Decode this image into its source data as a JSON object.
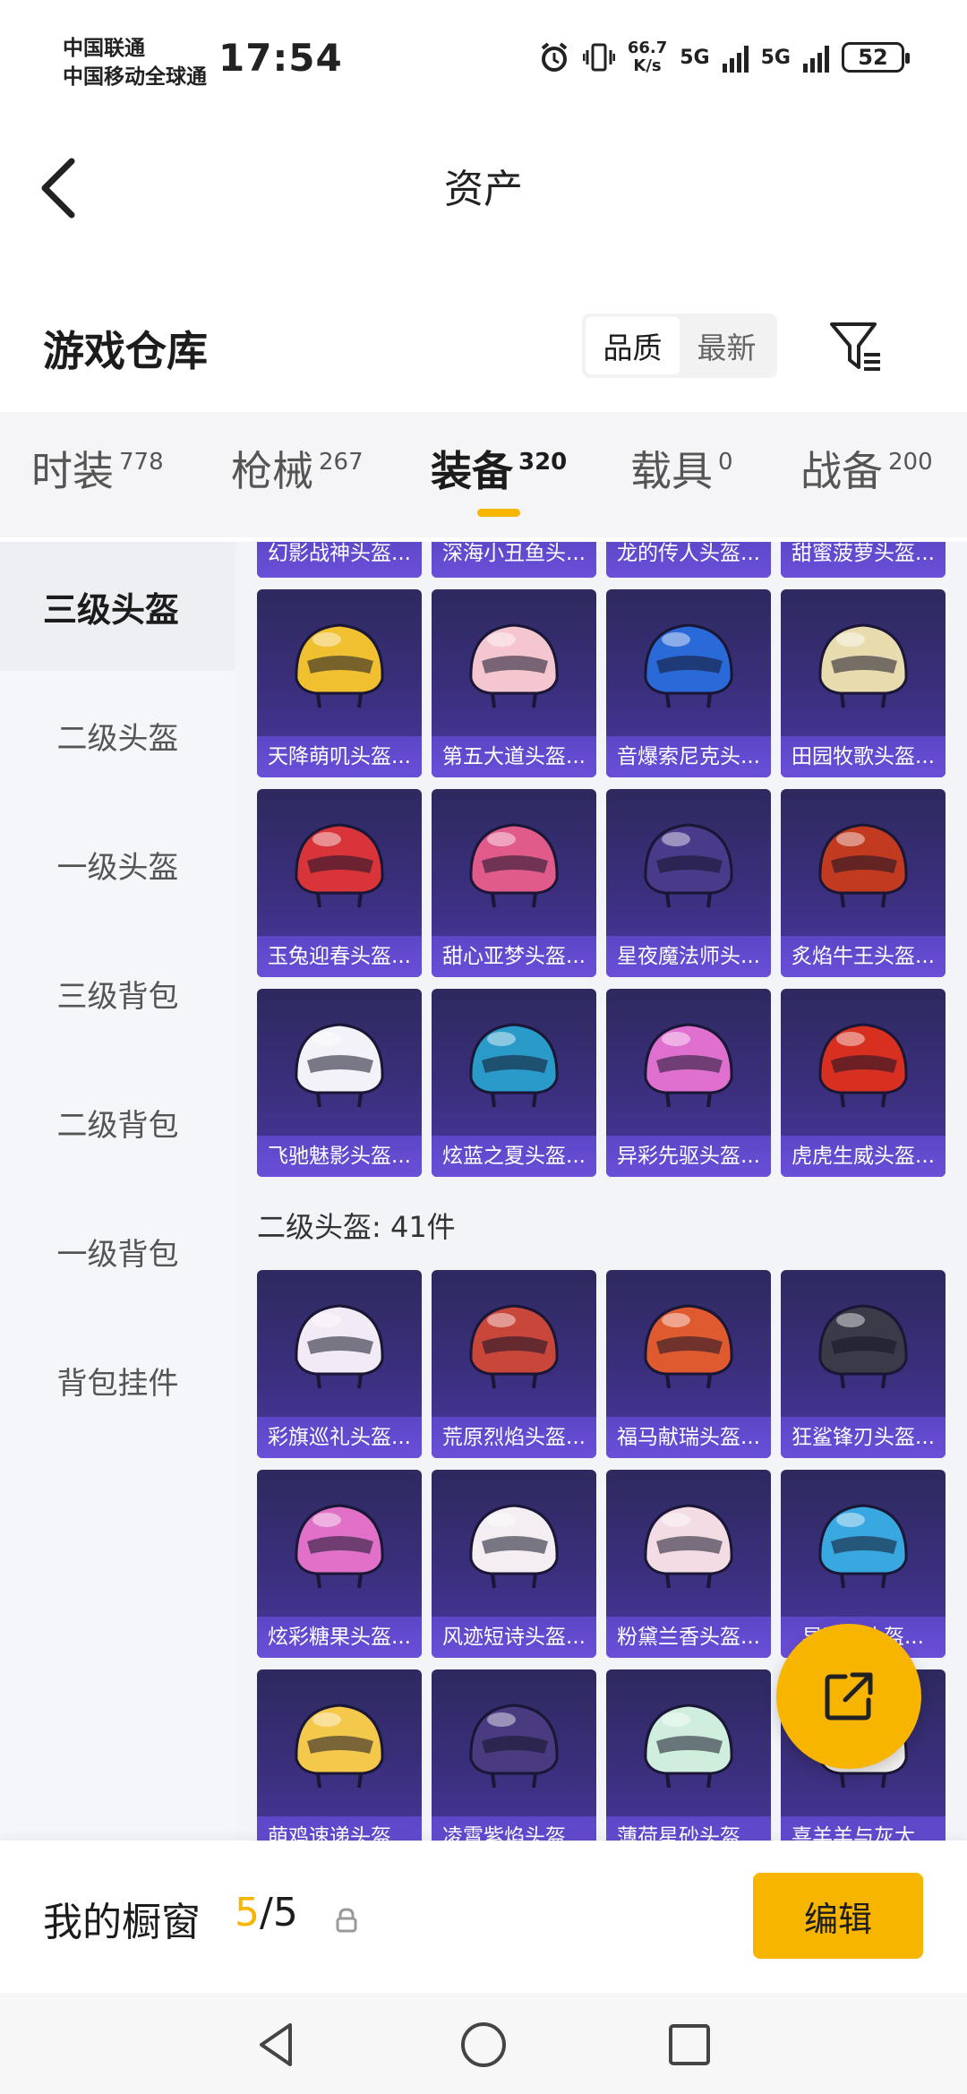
{
  "status_bar": {
    "carrier_1": "中国联通",
    "carrier_2": "中国移动全球通",
    "time": "17:54",
    "speed_value": "66.7",
    "speed_unit": "K/s",
    "net_1": "5G",
    "net_2": "5G",
    "battery": "52"
  },
  "header": {
    "title": "资产"
  },
  "warehouse": {
    "title": "游戏仓库",
    "sort_options": [
      "品质",
      "最新"
    ],
    "sort_selected": "品质"
  },
  "tabs": [
    {
      "label": "时装",
      "count": "778"
    },
    {
      "label": "枪械",
      "count": "267"
    },
    {
      "label": "装备",
      "count": "320",
      "active": true
    },
    {
      "label": "载具",
      "count": "0"
    },
    {
      "label": "战备",
      "count": "200"
    }
  ],
  "sidebar": {
    "items": [
      {
        "label": "三级头盔",
        "active": true
      },
      {
        "label": "二级头盔"
      },
      {
        "label": "一级头盔"
      },
      {
        "label": "三级背包"
      },
      {
        "label": "二级背包"
      },
      {
        "label": "一级背包"
      },
      {
        "label": "背包挂件"
      }
    ]
  },
  "level3_items": [
    {
      "name": "幻影战神头盔...",
      "color": "#8a6bd1"
    },
    {
      "name": "深海小丑鱼头...",
      "color": "#3a7bd5"
    },
    {
      "name": "龙的传人头盔...",
      "color": "#c89a3a"
    },
    {
      "name": "甜蜜菠萝头盔...",
      "color": "#e0c060"
    },
    {
      "name": "天降萌叽头盔...",
      "color": "#f0c030"
    },
    {
      "name": "第五大道头盔...",
      "color": "#f4c6d0"
    },
    {
      "name": "音爆索尼克头...",
      "color": "#2a6ad8"
    },
    {
      "name": "田园牧歌头盔...",
      "color": "#e8dcae"
    },
    {
      "name": "玉兔迎春头盔...",
      "color": "#d8343a"
    },
    {
      "name": "甜心亚梦头盔...",
      "color": "#e05a8a"
    },
    {
      "name": "星夜魔法师头...",
      "color": "#4a3a8a"
    },
    {
      "name": "炙焰牛王头盔...",
      "color": "#c23a20"
    },
    {
      "name": "飞驰魅影头盔...",
      "color": "#f2f2f8"
    },
    {
      "name": "炫蓝之夏头盔...",
      "color": "#2a9ac8"
    },
    {
      "name": "异彩先驱头盔...",
      "color": "#e070d0"
    },
    {
      "name": "虎虎生威头盔...",
      "color": "#d83020"
    }
  ],
  "level2_section": {
    "label": "二级头盔: 41件"
  },
  "level2_items": [
    {
      "name": "彩旗巡礼头盔...",
      "color": "#f2eaf4"
    },
    {
      "name": "荒原烈焰头盔...",
      "color": "#c8463a"
    },
    {
      "name": "福马献瑞头盔...",
      "color": "#e05a30"
    },
    {
      "name": "狂鲨锋刃头盔...",
      "color": "#3a3a48"
    },
    {
      "name": "炫彩糖果头盔...",
      "color": "#e070c8"
    },
    {
      "name": "风迹短诗头盔...",
      "color": "#f4eef2"
    },
    {
      "name": "粉黛兰香头盔...",
      "color": "#f4dce4"
    },
    {
      "name": "异骑...头盔...",
      "color": "#3aa8e0"
    },
    {
      "name": "萌鸡速递头盔...",
      "color": "#f4c84a"
    },
    {
      "name": "凌霄紫焰头盔...",
      "color": "#4a3a80"
    },
    {
      "name": "薄荷星砂头盔...",
      "color": "#cfeedd"
    },
    {
      "name": "喜羊羊与灰太...",
      "color": "#f4f0f0"
    }
  ],
  "bottom": {
    "showcase_label": "我的橱窗",
    "showcase_current": "5",
    "showcase_total": "/5",
    "edit_label": "编辑"
  },
  "colors": {
    "accent": "#f7b500",
    "card_bg": "#3b2f7e",
    "card_label_bg": "#6a4fd8"
  }
}
